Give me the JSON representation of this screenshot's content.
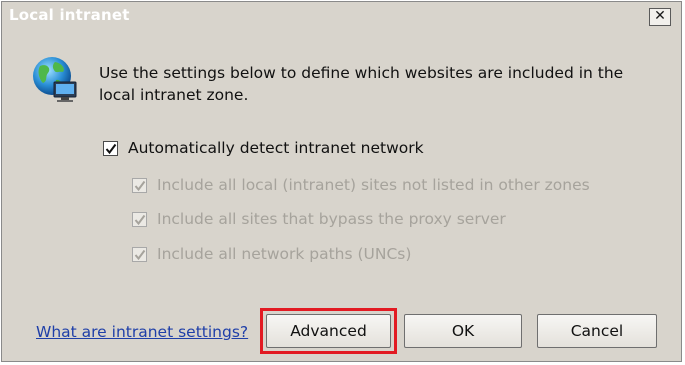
{
  "window": {
    "title": "Local intranet",
    "close_glyph": "✕"
  },
  "main": {
    "description": "Use the settings below to define which websites are included in the local intranet zone.",
    "icon": "globe-network-icon"
  },
  "options": {
    "auto_detect": {
      "label": "Automatically detect intranet network",
      "checked": true,
      "enabled": true
    },
    "include_local_sites": {
      "label": "Include all local (intranet) sites not listed in other zones",
      "checked": true,
      "enabled": false
    },
    "include_proxy_bypass": {
      "label": "Include all sites that bypass the proxy server",
      "checked": true,
      "enabled": false
    },
    "include_unc_paths": {
      "label": "Include all network paths (UNCs)",
      "checked": true,
      "enabled": false
    }
  },
  "footer": {
    "help_link": "What are intranet settings?",
    "advanced_label": "Advanced",
    "ok_label": "OK",
    "cancel_label": "Cancel"
  },
  "colors": {
    "highlight": "#e21a22",
    "link": "#1f3fa8",
    "dialog_bg": "#d8d4cc"
  }
}
